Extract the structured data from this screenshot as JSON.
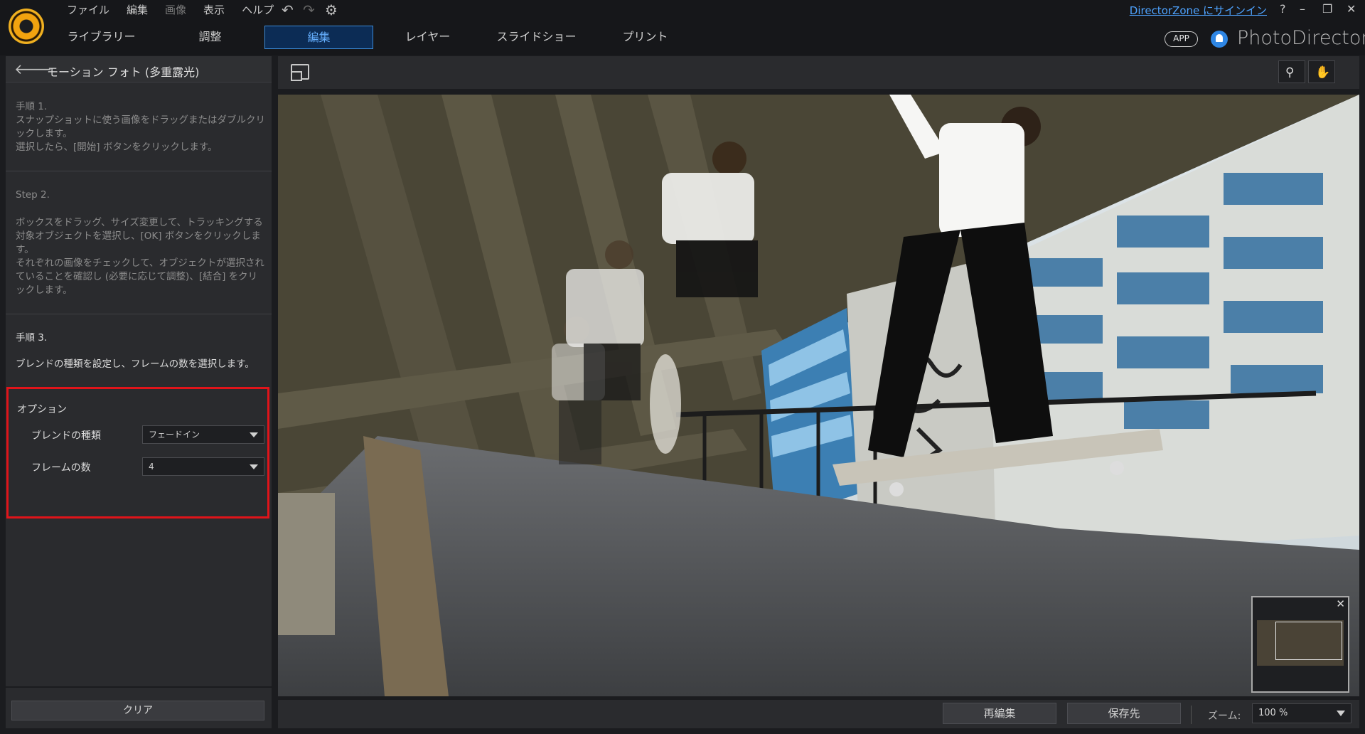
{
  "menu": [
    "ファイル",
    "編集",
    "画像",
    "表示",
    "ヘルプ"
  ],
  "menu_disabled": [
    "画像"
  ],
  "tabs": [
    "ライブラリー",
    "調整",
    "編集",
    "レイヤー",
    "スライドショー",
    "プリント"
  ],
  "active_tab": "編集",
  "header": {
    "signin": "DirectorZone にサインイン",
    "help": "?",
    "app_badge": "APP",
    "brand": "PhotoDirector"
  },
  "panel": {
    "title": "モーション フォト (多重露光)",
    "step1_title": "手順 1.",
    "step1_text": "スナップショットに使う画像をドラッグまたはダブルクリックします。",
    "step1_text2": "選択したら、[開始] ボタンをクリックします。",
    "step2_title": "Step 2.",
    "step2_text": "ボックスをドラッグ、サイズ変更して、トラッキングする対象オブジェクトを選択し、[OK] ボタンをクリックします。",
    "step2_text2": "それぞれの画像をチェックして、オブジェクトが選択されていることを確認し (必要に応じて調整)、[結合] をクリックします。",
    "step3_title": "手順 3.",
    "step3_text": "ブレンドの種類を設定し、フレームの数を選択します。",
    "options_title": "オプション",
    "blend_label": "ブレンドの種類",
    "blend_value": "フェードイン",
    "frames_label": "フレームの数",
    "frames_value": "4",
    "clear_button": "クリア"
  },
  "bottom": {
    "reedit": "再編集",
    "save_to": "保存先",
    "zoom_label": "ズーム:",
    "zoom_value": "100 %"
  },
  "colors": {
    "accent": "#3c8bd8",
    "highlight_box": "#e0141a",
    "link": "#4ea3ff"
  }
}
